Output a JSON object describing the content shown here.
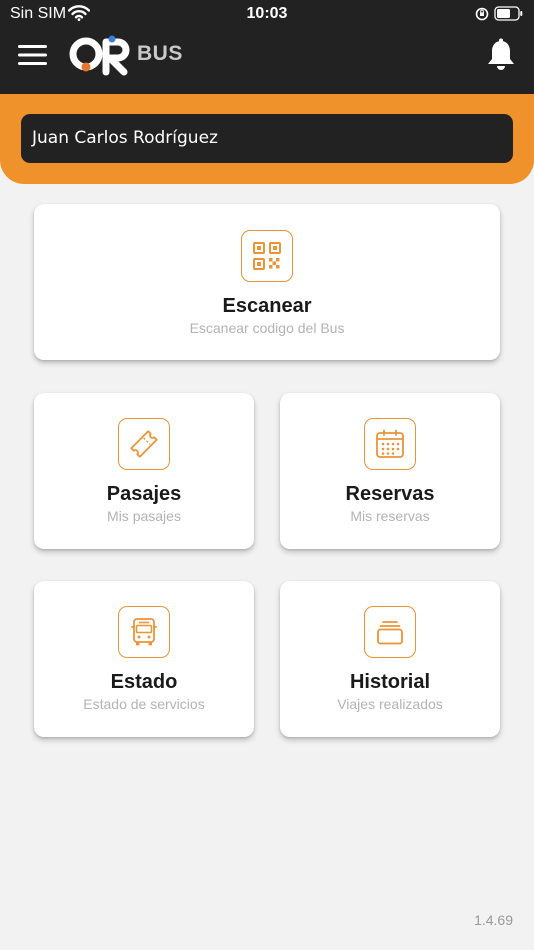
{
  "status_bar": {
    "carrier": "Sin SIM",
    "time": "10:03",
    "icons": [
      "wifi-icon",
      "orientation-lock-icon",
      "battery-icon"
    ]
  },
  "app_bar": {
    "logo_text": "QR",
    "logo_suffix": "BUS",
    "icons": [
      "menu-icon",
      "bell-icon"
    ]
  },
  "user": {
    "name": "Juan Carlos Rodríguez"
  },
  "cards": {
    "scan": {
      "title": "Escanear",
      "subtitle": "Escanear codigo del Bus",
      "icon": "qr-code-icon"
    },
    "tickets": {
      "title": "Pasajes",
      "subtitle": "Mis pasajes",
      "icon": "ticket-icon"
    },
    "reservations": {
      "title": "Reservas",
      "subtitle": "Mis reservas",
      "icon": "calendar-icon"
    },
    "status": {
      "title": "Estado",
      "subtitle": "Estado de servicios",
      "icon": "bus-icon"
    },
    "history": {
      "title": "Historial",
      "subtitle": "Viajes realizados",
      "icon": "history-icon"
    }
  },
  "version": "1.4.69",
  "colors": {
    "accent": "#f0922b",
    "dark": "#222222",
    "background": "#f2f2f2",
    "logo_dot_orange": "#e8742e",
    "logo_dot_blue": "#3b7ddb"
  }
}
